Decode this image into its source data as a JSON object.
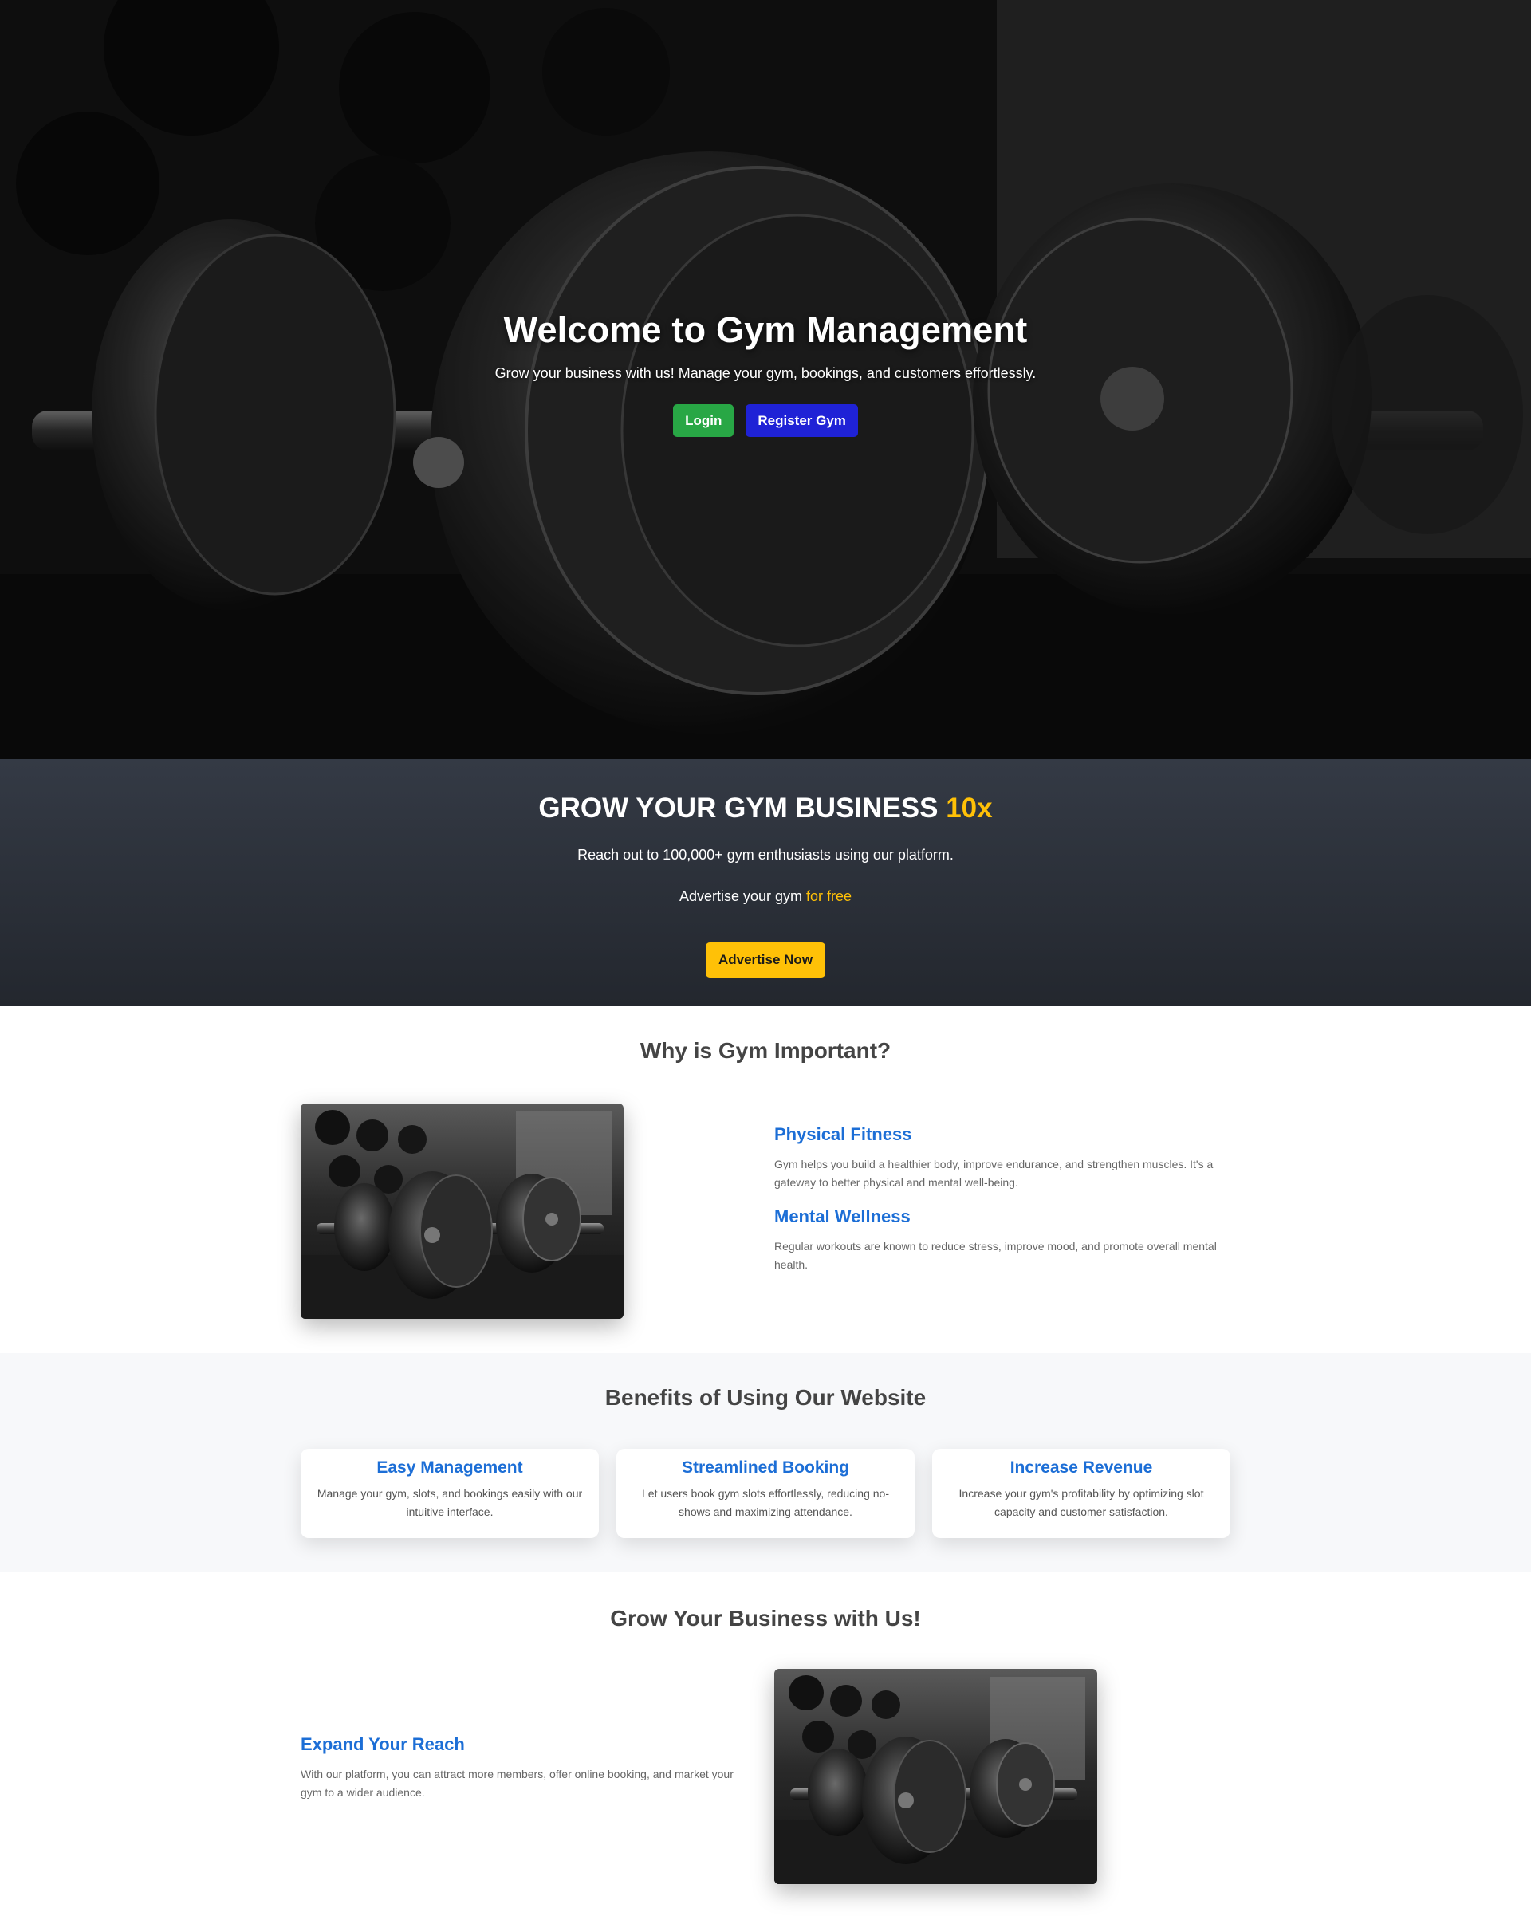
{
  "hero": {
    "title": "Welcome to Gym Management",
    "subtitle": "Grow your business with us! Manage your gym, bookings, and customers effortlessly.",
    "login_label": "Login",
    "register_label": "Register Gym"
  },
  "promo": {
    "title_main": "GROW YOUR GYM BUSINESS ",
    "title_accent": "10x",
    "line1": "Reach out to 100,000+ gym enthusiasts using our platform.",
    "line2_main": "Advertise your gym ",
    "line2_accent": "for free",
    "button_label": "Advertise Now"
  },
  "why": {
    "title": "Why is Gym Important?",
    "features": [
      {
        "title": "Physical Fitness",
        "description": "Gym helps you build a healthier body, improve endurance, and strengthen muscles. It's a gateway to better physical and mental well-being."
      },
      {
        "title": "Mental Wellness",
        "description": "Regular workouts are known to reduce stress, improve mood, and promote overall mental health."
      }
    ]
  },
  "benefits": {
    "title": "Benefits of Using Our Website",
    "cards": [
      {
        "title": "Easy Management",
        "description": "Manage your gym, slots, and bookings easily with our intuitive interface."
      },
      {
        "title": "Streamlined Booking",
        "description": "Let users book gym slots effortlessly, reducing no-shows and maximizing attendance."
      },
      {
        "title": "Increase Revenue",
        "description": "Increase your gym's profitability by optimizing slot capacity and customer satisfaction."
      }
    ]
  },
  "grow": {
    "title": "Grow Your Business with Us!",
    "feature_title": "Expand Your Reach",
    "feature_description": "With our platform, you can attract more members, offer online booking, and market your gym to a wider audience."
  },
  "colors": {
    "login_button": "#28a745",
    "register_button": "#1f22d6",
    "accent_yellow": "#ffc107",
    "heading_blue": "#1c6ed6"
  }
}
